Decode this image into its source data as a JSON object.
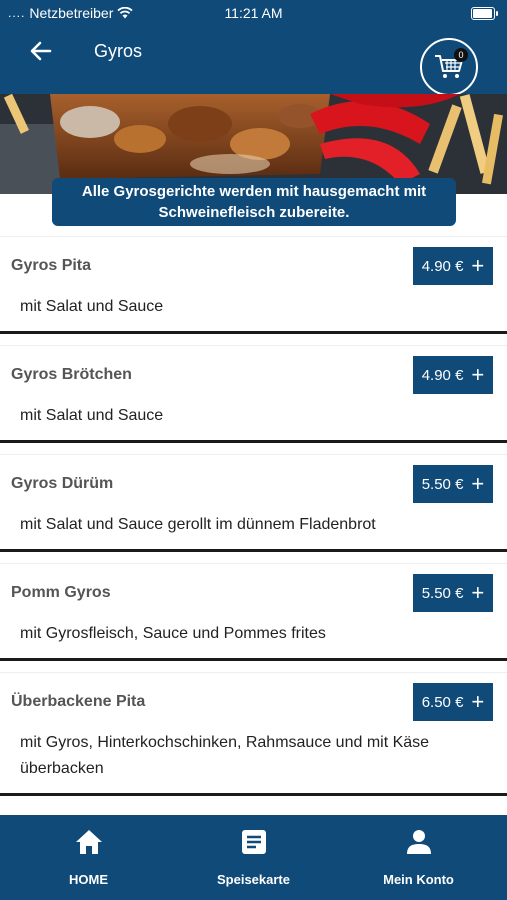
{
  "status_bar": {
    "carrier": "Netzbetreiber",
    "time": "11:21 AM"
  },
  "header": {
    "title": "Gyros",
    "cart_count": "0"
  },
  "banner": {
    "note": "Alle Gyrosgerichte werden mit hausgemacht mit Schweinefleisch zubereite."
  },
  "items": [
    {
      "name": "Gyros Pita",
      "price": "4.90 €",
      "desc": "mit Salat und Sauce"
    },
    {
      "name": "Gyros Brötchen",
      "price": "4.90 €",
      "desc": "mit Salat und Sauce"
    },
    {
      "name": "Gyros Dürüm",
      "price": "5.50 €",
      "desc": "mit Salat und Sauce gerollt im dünnem Fladenbrot"
    },
    {
      "name": "Pomm Gyros",
      "price": "5.50 €",
      "desc": "mit Gyrosfleisch, Sauce und Pommes frites"
    },
    {
      "name": "Überbackene Pita",
      "price": "6.50 €",
      "desc": "mit Gyros, Hinterkochschinken, Rahmsauce und mit Käse überbacken"
    }
  ],
  "bottom_nav": [
    {
      "label": "HOME",
      "icon": "home-icon"
    },
    {
      "label": "Speisekarte",
      "icon": "menu-card-icon"
    },
    {
      "label": "Mein Konto",
      "icon": "user-icon"
    }
  ],
  "colors": {
    "primary": "#0f4a78",
    "tomato": "#d8151d",
    "meat": "#8a4a22"
  }
}
